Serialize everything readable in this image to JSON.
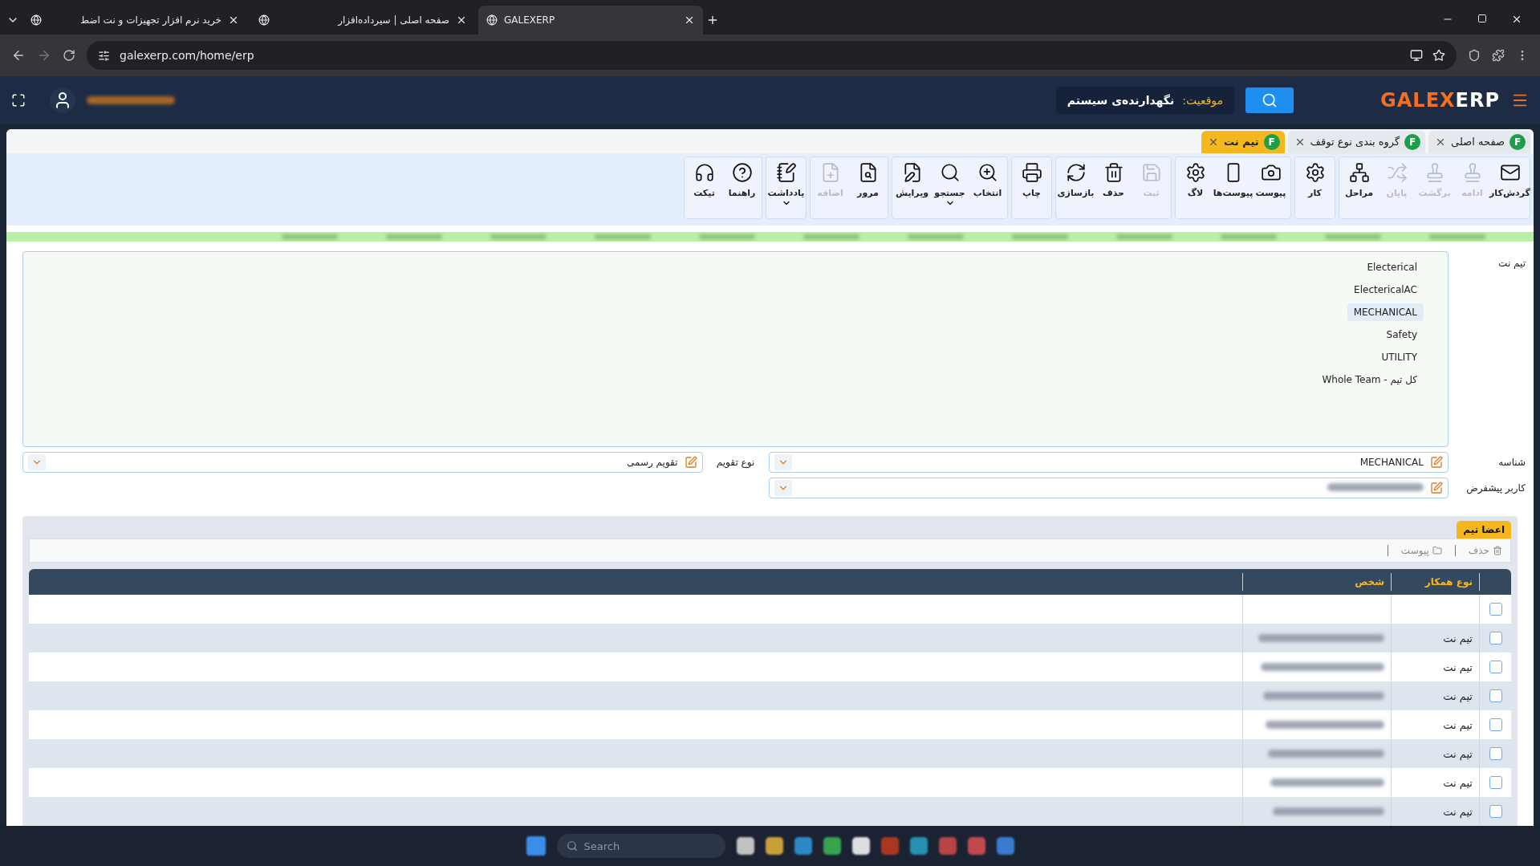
{
  "browser": {
    "tabs": [
      {
        "title": "GALEXERP",
        "selected": true
      },
      {
        "title": "صفحه اصلی | سیرداده‌افزار",
        "selected": false
      },
      {
        "title": "خرید نرم افزار تجهیزات و نت اضط",
        "selected": false
      }
    ],
    "url": "galexerp.com/home/erp"
  },
  "header": {
    "logo": {
      "brand": "GALEX",
      "suffix": "ERP"
    },
    "location_label": "موقعیت:",
    "location_value": "نگهدارنده‌ی سیستم"
  },
  "page_tabs": [
    {
      "label": "صفحه اصلی",
      "badge": "F",
      "selected": false
    },
    {
      "label": "گروه بندی نوع توقف",
      "badge": "F",
      "selected": false
    },
    {
      "label": "تیم نت",
      "badge": "F",
      "selected": true
    }
  ],
  "toolbar": [
    [
      {
        "label": "گردش‌کار",
        "disabled": false
      },
      {
        "label": "ادامه",
        "disabled": true
      },
      {
        "label": "برگشت",
        "disabled": true
      },
      {
        "label": "پایان",
        "disabled": true
      },
      {
        "label": "مراحل",
        "disabled": false
      }
    ],
    [
      {
        "label": "کار",
        "disabled": false
      }
    ],
    [
      {
        "label": "پیوست",
        "disabled": false
      },
      {
        "label": "پیوست‌ها",
        "disabled": false
      },
      {
        "label": "لاگ",
        "disabled": false
      }
    ],
    [
      {
        "label": "ثبت",
        "disabled": true
      },
      {
        "label": "حذف",
        "disabled": false
      },
      {
        "label": "بازسازی",
        "disabled": false
      }
    ],
    [
      {
        "label": "چاپ",
        "disabled": false
      }
    ],
    [
      {
        "label": "انتخاب",
        "disabled": false
      },
      {
        "label": "جستجو",
        "disabled": false,
        "dropdown": true
      },
      {
        "label": "ویرایش",
        "disabled": false
      }
    ],
    [
      {
        "label": "مرور",
        "disabled": false
      },
      {
        "label": "اضافه",
        "disabled": true
      }
    ],
    [
      {
        "label": "یادداشت",
        "disabled": false,
        "dropdown": true
      }
    ],
    [
      {
        "label": "راهنما",
        "disabled": false
      },
      {
        "label": "تیکت",
        "disabled": false
      }
    ]
  ],
  "team_list": {
    "label": "تیم نت",
    "options": [
      {
        "label": "Electerical",
        "selected": false
      },
      {
        "label": "ElectericalAC",
        "selected": false
      },
      {
        "label": "MECHANICAL",
        "selected": true
      },
      {
        "label": "Safety",
        "selected": false
      },
      {
        "label": "UTILITY",
        "selected": false
      },
      {
        "label": "Whole Team - کل تیم",
        "selected": false
      }
    ]
  },
  "fields": {
    "id": {
      "label": "شناسه",
      "value": "MECHANICAL"
    },
    "calendar": {
      "label": "نوع تقویم",
      "value": "تقویم رسمی"
    },
    "default_user": {
      "label": "کاربر پیشفرض"
    }
  },
  "members": {
    "title": "اعضا تیم",
    "actions": [
      "حذف",
      "پیوست"
    ],
    "columns": [
      "نوع همکار",
      "شخص"
    ],
    "rows": [
      {
        "checked": false
      },
      {
        "type": "تیم نت",
        "checked": false
      },
      {
        "type": "تیم نت",
        "checked": false
      },
      {
        "type": "تیم نت",
        "checked": false
      },
      {
        "type": "تیم نت",
        "checked": false
      },
      {
        "type": "تیم نت",
        "checked": false
      },
      {
        "type": "تیم نت",
        "checked": false
      },
      {
        "type": "تیم نت",
        "checked": false
      }
    ]
  },
  "taskbar": {
    "search_placeholder": "Search"
  }
}
